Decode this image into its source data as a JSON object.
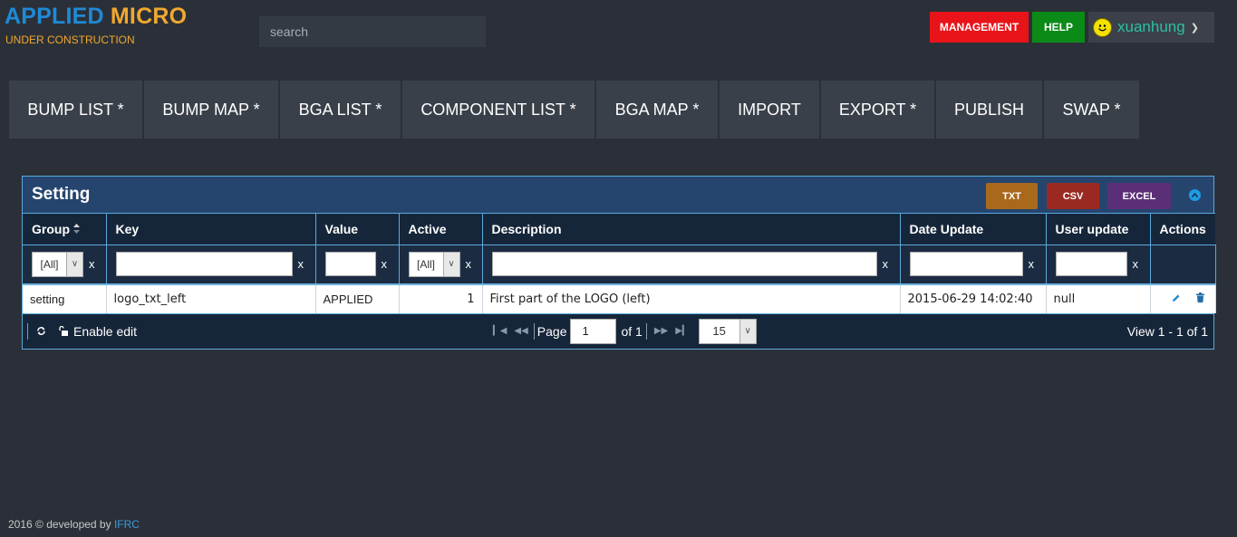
{
  "header": {
    "logo_left": "APPLIED",
    "logo_right": "MICRO",
    "logo_sub": "UNDER CONSTRUCTION",
    "search_placeholder": "search",
    "management_label": "MANAGEMENT",
    "help_label": "HELP",
    "user_name": "xuanhung"
  },
  "nav": [
    {
      "label": "BUMP LIST *"
    },
    {
      "label": "BUMP MAP *"
    },
    {
      "label": "BGA LIST *"
    },
    {
      "label": "COMPONENT LIST *"
    },
    {
      "label": "BGA MAP *"
    },
    {
      "label": "IMPORT"
    },
    {
      "label": "EXPORT *"
    },
    {
      "label": "PUBLISH"
    },
    {
      "label": "SWAP *"
    }
  ],
  "panel": {
    "title": "Setting",
    "export_txt": "TXT",
    "export_csv": "CSV",
    "export_excel": "EXCEL"
  },
  "table": {
    "columns": [
      "Group",
      "Key",
      "Value",
      "Active",
      "Description",
      "Date Update",
      "User update",
      "Actions"
    ],
    "filter_select_value": "[All]",
    "filter_clear": "x",
    "rows": [
      {
        "group": "setting",
        "key": "logo_txt_left",
        "value": "APPLIED",
        "active": "1",
        "description": "First part of the LOGO (left)",
        "date_update": "2015-06-29 14:02:40",
        "user_update": "null"
      }
    ]
  },
  "pager": {
    "enable_edit": "Enable edit",
    "page_label": "Page",
    "page_value": "1",
    "of_label": "of 1",
    "page_size": "15",
    "view_text": "View 1 - 1 of 1"
  },
  "footer": {
    "text": "2016 © developed by",
    "link": "IFRC"
  },
  "colors": {
    "background": "#2b3038",
    "management": "#e8141a",
    "help": "#0c8a18",
    "panel_header": "#25456f",
    "txt": "#a8691c",
    "csv": "#9a2a21",
    "excel": "#5b2f78"
  }
}
